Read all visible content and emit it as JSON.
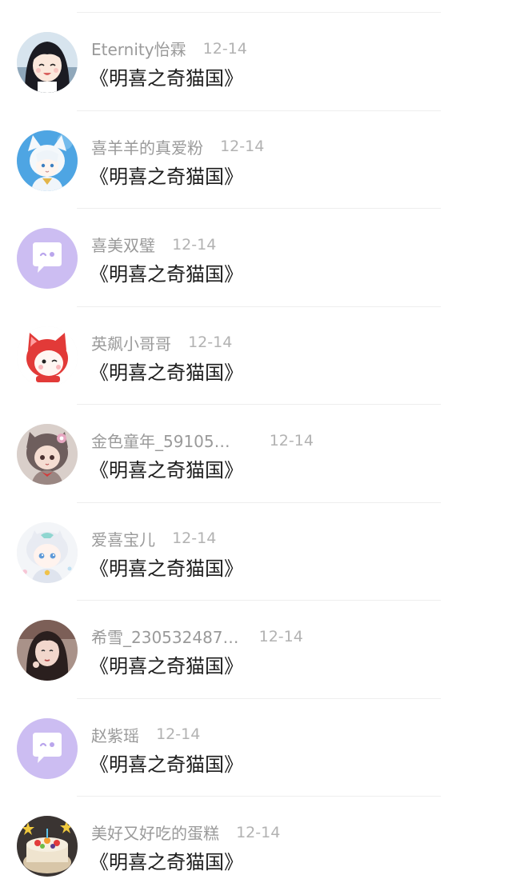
{
  "comments": [
    {
      "user": "Eternity怡霖",
      "date": "12-14",
      "title": "《明喜之奇猫国》",
      "avatar_icon": "anime-girl-avatar-icon",
      "date_gap": 16
    },
    {
      "user": "喜羊羊的真爱粉",
      "date": "12-14",
      "title": "《明喜之奇猫国》",
      "avatar_icon": "white-cat-boy-avatar-icon",
      "date_gap": 16
    },
    {
      "user": "喜美双璧",
      "date": "12-14",
      "title": "《明喜之奇猫国》",
      "avatar_icon": "default-chat-avatar-icon",
      "date_gap": 16
    },
    {
      "user": "英飙小哥哥",
      "date": "12-14",
      "title": "《明喜之奇猫国》",
      "avatar_icon": "red-hood-cat-avatar-icon",
      "date_gap": 16
    },
    {
      "user": "金色童年_59105…",
      "date": "12-14",
      "title": "《明喜之奇猫国》",
      "avatar_icon": "chibi-girl-avatar-icon",
      "date_gap": 44
    },
    {
      "user": "爱喜宝儿",
      "date": "12-14",
      "title": "《明喜之奇猫国》",
      "avatar_icon": "white-haired-chibi-avatar-icon",
      "date_gap": 16
    },
    {
      "user": "希雪_230532487…",
      "date": "12-14",
      "title": "《明喜之奇猫国》",
      "avatar_icon": "dark-haired-girl-avatar-icon",
      "date_gap": 20
    },
    {
      "user": "赵紫瑶",
      "date": "12-14",
      "title": "《明喜之奇猫国》",
      "avatar_icon": "default-chat-avatar-icon",
      "date_gap": 16
    },
    {
      "user": "美好又好吃的蛋糕",
      "date": "12-14",
      "title": "《明喜之奇猫国》",
      "avatar_icon": "cake-avatar-icon",
      "date_gap": 16
    }
  ],
  "colors": {
    "name": "#9a9a9a",
    "date": "#b2b2b2",
    "title": "#1c1c1c",
    "divider": "#eeeeee",
    "default_avatar_bg": "#ccbdf2"
  }
}
